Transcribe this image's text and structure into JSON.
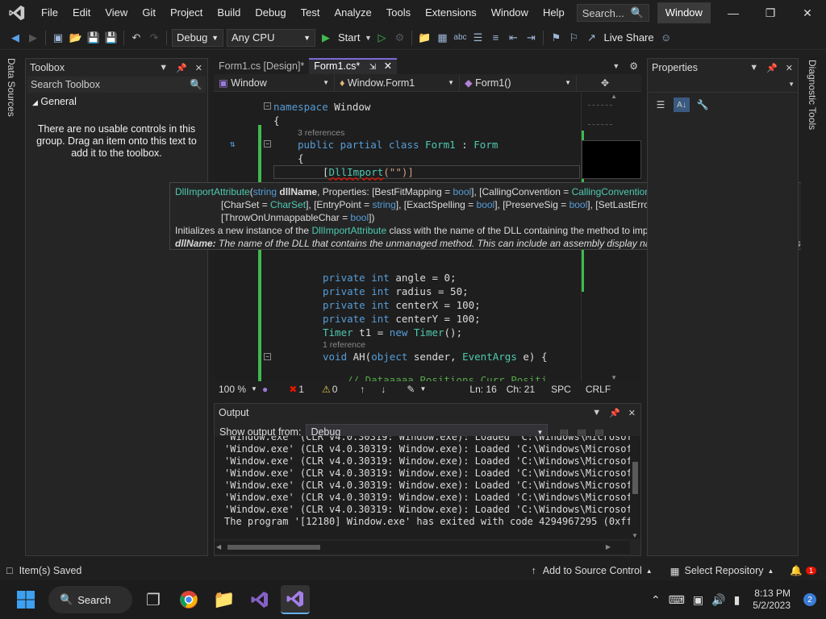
{
  "menu": {
    "items": [
      "File",
      "Edit",
      "View",
      "Git",
      "Project",
      "Build",
      "Debug",
      "Test",
      "Analyze",
      "Tools",
      "Extensions",
      "Window",
      "Help"
    ],
    "search_placeholder": "Search...",
    "window_title": "Window"
  },
  "toolbar": {
    "config": "Debug",
    "platform": "Any CPU",
    "start_label": "Start",
    "live_share": "Live Share"
  },
  "left_strip": {
    "label": "Data Sources"
  },
  "right_strip": {
    "label": "Diagnostic Tools"
  },
  "toolbox": {
    "title": "Toolbox",
    "search_placeholder": "Search Toolbox",
    "group": "General",
    "empty_message": "There are no usable controls in this group. Drag an item onto this text to add it to the toolbox."
  },
  "editor": {
    "tabs": [
      {
        "label": "Form1.cs [Design]*"
      },
      {
        "label": "Form1.cs*"
      }
    ],
    "nav": {
      "project": "Window",
      "class": "Window.Form1",
      "member": "Form1()"
    },
    "code": {
      "namespace_kw": "namespace",
      "namespace_name": "Window",
      "open_brace": "{",
      "refs_3": "3 references",
      "class_mods": "public partial class",
      "class_name": "Form1",
      "colon": " : ",
      "base": "Form",
      "attr_open": "[",
      "attr_name": "DllImport",
      "attr_args": "(\"\")]",
      "fields": [
        {
          "kw": "private int",
          "rest": " angle = 0;"
        },
        {
          "kw": "private int",
          "rest": " radius = 50;"
        },
        {
          "kw": "private int",
          "rest": " centerX = 100;"
        },
        {
          "kw": "private int",
          "rest": " centerY = 100;"
        }
      ],
      "timer_type": "Timer",
      "timer_rest": " t1 = ",
      "timer_new": "new",
      "timer_ctor": " Timer",
      "timer_end": "();",
      "refs_1": "1 reference",
      "method_kw": "void",
      "method_name": " AH(",
      "method_param_kw": "object",
      "method_param": " sender, ",
      "method_param_type": "EventArgs",
      "method_end": " e) {",
      "partial_line": "// Dataaaaa Positions Curr Positi"
    },
    "status": {
      "zoom": "100 %",
      "errors": "1",
      "warnings": "0",
      "line": "Ln: 16",
      "col": "Ch: 21",
      "spc": "SPC",
      "eol": "CRLF"
    }
  },
  "tooltip": {
    "sig_name": "DllImportAttribute",
    "sig_paren": "(",
    "sig_kw": "string",
    "sig_param": " dllName",
    "sig_rest": ", Properties: [BestFitMapping = ",
    "bool": "bool",
    "p1": "], [CallingConvention = ",
    "callconv": "CallingConvention",
    "p2": "],",
    "l2a": "[CharSet = ",
    "charset": "CharSet",
    "l2b": "], [EntryPoint = ",
    "string_t": "string",
    "l2c": "], [ExactSpelling = ",
    "l2d": "], [PreserveSig = ",
    "l2e": "], [SetLastError = ",
    "l2f": "],",
    "l3a": "[ThrowOnUnmappableChar = ",
    "l3b": "])",
    "desc_a": "Initializes a new instance of the ",
    "desc_type": "DllImportAttribute",
    "desc_b": " class with the name of the DLL containing the method to import.",
    "param_label": "dllName:",
    "param_desc": " The name of the DLL that contains the unmanaged method. This can include an assembly display name, if the DLL is included in an assembly."
  },
  "properties": {
    "title": "Properties"
  },
  "output": {
    "title": "Output",
    "show_from_label": "Show output from:",
    "source": "Debug",
    "lines": [
      "'Window.exe' (CLR v4.0.30319: Window.exe): Loaded 'C:\\Windows\\Microsoft",
      "'Window.exe' (CLR v4.0.30319: Window.exe): Loaded 'C:\\Windows\\Microsoft",
      "'Window.exe' (CLR v4.0.30319: Window.exe): Loaded 'C:\\Windows\\Microsoft",
      "'Window.exe' (CLR v4.0.30319: Window.exe): Loaded 'C:\\Windows\\Microsoft",
      "'Window.exe' (CLR v4.0.30319: Window.exe): Loaded 'C:\\Windows\\Microsoft",
      "'Window.exe' (CLR v4.0.30319: Window.exe): Loaded 'C:\\Windows\\Microsoft",
      "'Window.exe' (CLR v4.0.30319: Window.exe): Loaded 'C:\\Windows\\Microsoft",
      "The program '[12180] Window.exe' has exited with code 4294967295 (0xfff"
    ]
  },
  "statusbar": {
    "left": "Item(s) Saved",
    "source_control": "Add to Source Control",
    "repo": "Select Repository",
    "notif_count": "1"
  },
  "taskbar": {
    "search": "Search",
    "time": "8:13 PM",
    "date": "5/2/2023",
    "badge": "2"
  },
  "colors": {
    "accent": "#7b6ad8",
    "keyword": "#569cd6",
    "type": "#4ec9b0",
    "string": "#d69d85",
    "error": "#e51400"
  }
}
